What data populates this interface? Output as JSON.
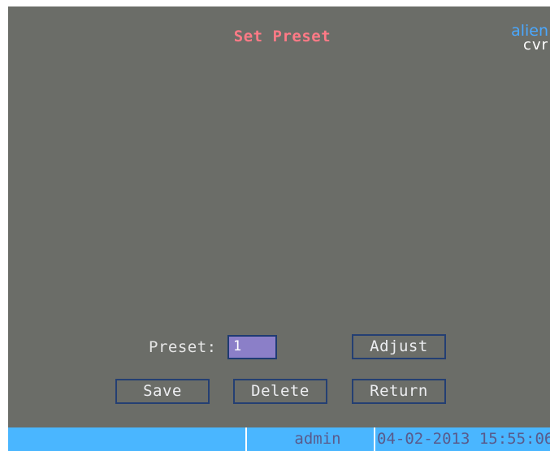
{
  "screen": {
    "title": "Set Preset",
    "logo": {
      "top": "alien",
      "bottom": "cvr"
    }
  },
  "preset": {
    "label": "Preset:",
    "value": "1"
  },
  "buttons": {
    "adjust": "Adjust",
    "save": "Save",
    "delete": "Delete",
    "return": "Return"
  },
  "status": {
    "user": "admin",
    "datetime": "04-02-2013 15:55:06"
  },
  "colors": {
    "background": "#6b6d68",
    "title": "#ff7a86",
    "statusbar": "#4ab6ff",
    "input_fill": "#8b7fc8"
  }
}
